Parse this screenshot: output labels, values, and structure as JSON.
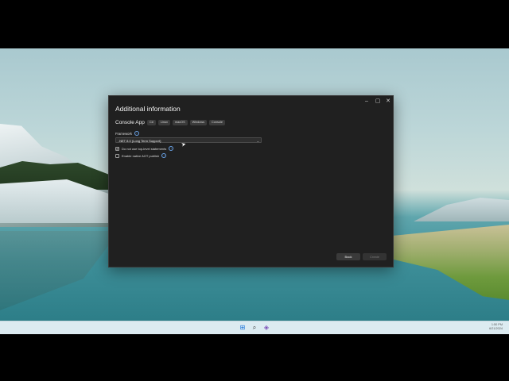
{
  "dialog": {
    "title": "Additional information",
    "window_controls": {
      "minimize": "–",
      "maximize": "▢",
      "close": "✕"
    },
    "app_name": "Console App",
    "tags": [
      "C#",
      "Linux",
      "macOS",
      "Windows",
      "Console"
    ],
    "framework": {
      "label": "Framework",
      "selected": ".NET 8.0 (Long Term Support)"
    },
    "options": [
      {
        "label": "Do not use top-level statements",
        "checked": true
      },
      {
        "label": "Enable native AOT publish",
        "checked": false
      }
    ],
    "buttons": {
      "back": "Back",
      "create": "Create"
    }
  },
  "taskbar": {
    "icons": [
      "windows-start-icon",
      "search-icon",
      "visual-studio-icon"
    ],
    "time": "1:50 PM",
    "date": "6/21/2024"
  },
  "colors": {
    "dialog_bg": "#202020",
    "accent": "#6aa3e8",
    "taskbar_bg": "#dcebf1"
  }
}
